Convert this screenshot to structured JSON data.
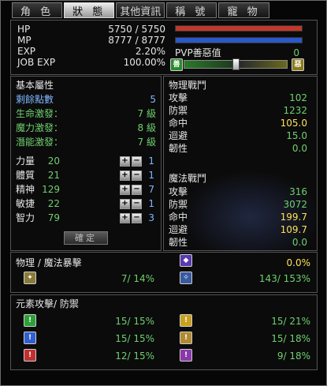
{
  "tabs": [
    "角 色",
    "狀 態",
    "其他資訊",
    "稱 號",
    "寵 物"
  ],
  "vitals": {
    "hp_label": "HP",
    "hp_value": "5750 / 5750",
    "mp_label": "MP",
    "mp_value": "8777 / 8777",
    "exp_label": "EXP",
    "exp_value": "2.20%",
    "jobexp_label": "JOB EXP",
    "jobexp_value": "100.00%",
    "pvp_label": "PVP善惡值",
    "pvp_value": "0",
    "hp_fraction": 1.0,
    "mp_fraction": 1.0,
    "pvp_fraction": 0.5,
    "hp_color": "#c0392b",
    "mp_color": "#2b57c9"
  },
  "basic": {
    "title": "基本屬性",
    "remaining_label": "剩餘點數",
    "remaining_value": "5",
    "life_label": "生命激發：",
    "life_value": "7 級",
    "magic_label": "魔力激發：",
    "magic_value": "8 級",
    "potential_label": "潛能激發：",
    "potential_value": "7 級",
    "stats": [
      {
        "label": "力量",
        "value": "20",
        "added": "1"
      },
      {
        "label": "體質",
        "value": "21",
        "added": "1"
      },
      {
        "label": "精神",
        "value": "129",
        "added": "7"
      },
      {
        "label": "敏捷",
        "value": "22",
        "added": "1"
      },
      {
        "label": "智力",
        "value": "79",
        "added": "3"
      }
    ],
    "confirm_label": "確定"
  },
  "physical": {
    "title": "物理戰鬥",
    "rows": [
      {
        "label": "攻擊",
        "value": "102"
      },
      {
        "label": "防禦",
        "value": "1232"
      },
      {
        "label": "命中",
        "value": "105.0"
      },
      {
        "label": "迴避",
        "value": "15.0"
      },
      {
        "label": "韌性",
        "value": "0.0"
      }
    ]
  },
  "magic": {
    "title": "魔法戰鬥",
    "rows": [
      {
        "label": "攻擊",
        "value": "316"
      },
      {
        "label": "防禦",
        "value": "3072"
      },
      {
        "label": "命中",
        "value": "199.7"
      },
      {
        "label": "迴避",
        "value": "109.7"
      },
      {
        "label": "韌性",
        "value": "0.0"
      }
    ]
  },
  "crit": {
    "title": "物理 / 魔法暴擊",
    "right_top": "0.0%",
    "left_values": "7/ 14%",
    "right_values": "143/ 153%"
  },
  "elements": {
    "title": "元素攻擊/ 防禦",
    "left": [
      {
        "values": "15/ 15%",
        "color": "#2e9e3a"
      },
      {
        "values": "15/ 15%",
        "color": "#2f5fd0"
      },
      {
        "values": "12/ 15%",
        "color": "#c03030"
      }
    ],
    "right": [
      {
        "values": "15/ 21%",
        "color": "#c8a020"
      },
      {
        "values": "15/ 18%",
        "color": "#b08a30"
      },
      {
        "values": "9/ 18%",
        "color": "#8a3aa8"
      }
    ]
  }
}
